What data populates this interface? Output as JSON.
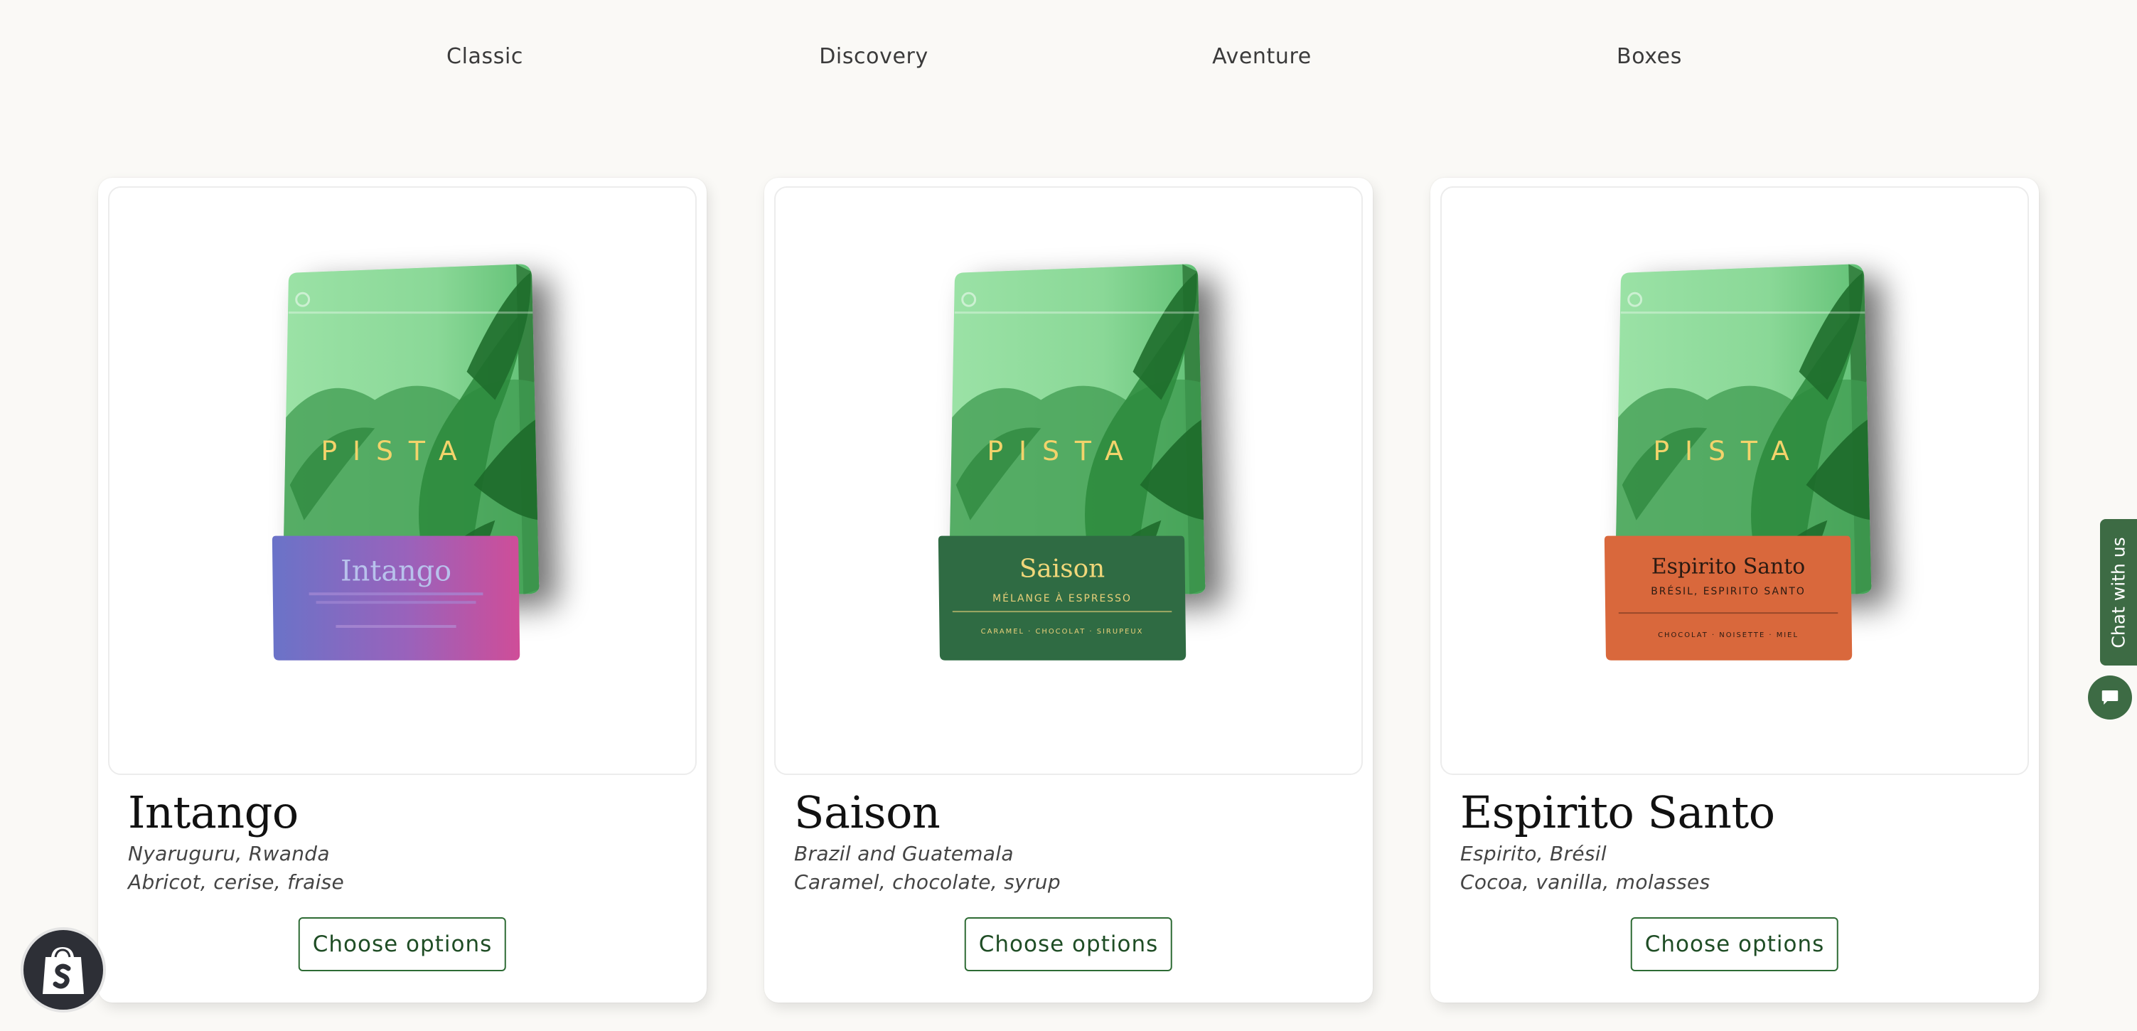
{
  "tabs": [
    "Classic",
    "Discovery",
    "Aventure",
    "Boxes"
  ],
  "products": [
    {
      "name": "Intango",
      "origin": "Nyaruguru, Rwanda",
      "notes": "Abricot, cerise, fraise",
      "button": "Choose options",
      "bag": {
        "brand": "PISTA",
        "label_title": "Intango",
        "label_sub": "",
        "label_notes": "",
        "label_color": "gradient"
      }
    },
    {
      "name": "Saison",
      "origin": "Brazil and Guatemala",
      "notes": "Caramel, chocolate, syrup",
      "button": "Choose options",
      "bag": {
        "brand": "PISTA",
        "label_title": "Saison",
        "label_sub": "MÉLANGE À ESPRESSO",
        "label_notes": "CARAMEL · CHOCOLAT · SIRUPEUX",
        "label_color": "#2f6b43"
      }
    },
    {
      "name": "Espirito Santo",
      "origin": "Espirito, Brésil",
      "notes": "Cocoa, vanilla, molasses",
      "button": "Choose options",
      "bag": {
        "brand": "PISTA",
        "label_title": "Espirito Santo",
        "label_sub": "BRÉSIL, ESPIRITO SANTO",
        "label_notes": "CHOCOLAT · NOISETTE · MIEL",
        "label_color": "#d9683c"
      }
    }
  ],
  "chat": {
    "label": "Chat with us"
  },
  "colors": {
    "accent": "#2d6b34",
    "background": "#faf9f6",
    "chat": "#3d6b44",
    "bag_light": "#8fdb9c",
    "bag_dark": "#1f6a2a"
  },
  "icons": {
    "chat": "chat-bubble-icon",
    "shopify": "shopify-bag-icon"
  }
}
